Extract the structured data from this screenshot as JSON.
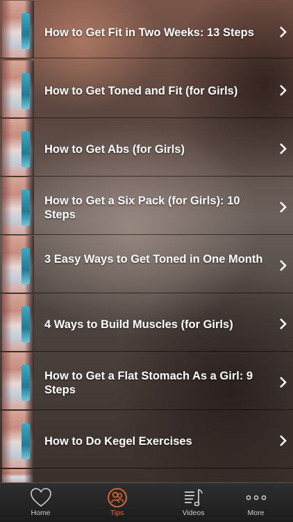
{
  "articles": [
    {
      "title": "How to Get Fit in Two Weeks: 13 Steps"
    },
    {
      "title": "How to Get Toned and Fit (for Girls)"
    },
    {
      "title": "How to Get Abs (for Girls)"
    },
    {
      "title": "How to Get a Six Pack (for Girls): 10 Steps"
    },
    {
      "title": "3 Easy Ways to Get Toned in One Month"
    },
    {
      "title": "4 Ways to Build Muscles (for Girls)"
    },
    {
      "title": "How to Get a Flat Stomach As a Girl: 9 Steps"
    },
    {
      "title": "How to Do Kegel Exercises"
    }
  ],
  "tabbar": {
    "tabs": [
      {
        "label": "Home",
        "icon": "heart-icon"
      },
      {
        "label": "Tips",
        "icon": "users-icon",
        "active": true
      },
      {
        "label": "Videos",
        "icon": "music-list-icon"
      },
      {
        "label": "More",
        "icon": "more-dots-icon"
      }
    ],
    "active_color": "#e8672a"
  }
}
